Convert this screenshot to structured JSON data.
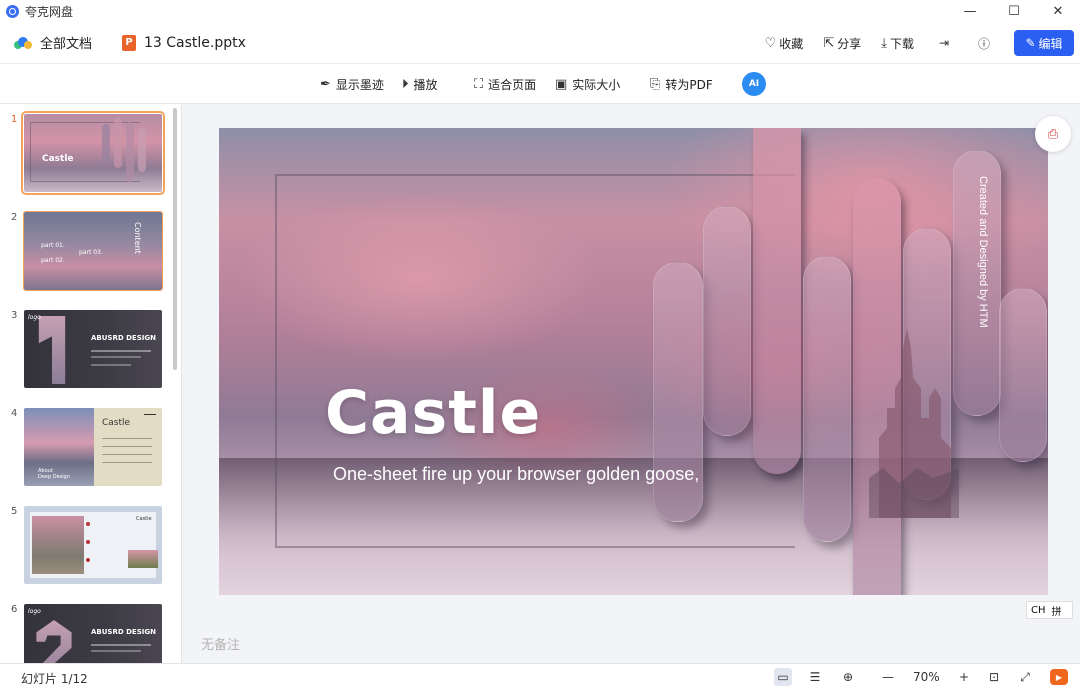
{
  "app": {
    "title": "夸克网盘"
  },
  "window": {
    "minimize": "—",
    "maximize": "☐",
    "close": "✕"
  },
  "header": {
    "breadcrumb": "全部文档",
    "file_icon_letter": "P",
    "file_name": "13 Castle.pptx",
    "actions": {
      "favorite": "收藏",
      "share": "分享",
      "download": "下载",
      "edit": "编辑"
    }
  },
  "toolbar": {
    "show_ink": "显示墨迹",
    "play": "播放",
    "fit_page": "适合页面",
    "actual_size": "实际大小",
    "to_pdf": "转为PDF",
    "ai": "AI"
  },
  "thumbnails": [
    {
      "num": "1",
      "title": "Castle",
      "selected": true
    },
    {
      "num": "2",
      "title": "Content",
      "part1": "part 01.",
      "part2": "part 02.",
      "part3": "part 03."
    },
    {
      "num": "3",
      "brand": "logo",
      "heading": "ABUSRD DESIGN"
    },
    {
      "num": "4",
      "title": "Castle",
      "caption1": "About",
      "caption2": "Deep Design"
    },
    {
      "num": "5",
      "title": "Castle"
    },
    {
      "num": "6",
      "brand": "logo",
      "heading": "ABUSRD DESIGN"
    }
  ],
  "slide": {
    "title": "Castle",
    "subtitle": "One-sheet fire up your browser golden goose,",
    "vertical_text": "Created and Designed by HTM",
    "notes": "无备注"
  },
  "ime": {
    "lang": "CH",
    "mode": "拼"
  },
  "status": {
    "slide_count": "幻灯片 1/12",
    "zoom": "70%"
  },
  "colors": {
    "accent": "#2b5ff2",
    "selection": "#f4a35b",
    "ppt": "#e8622a"
  }
}
